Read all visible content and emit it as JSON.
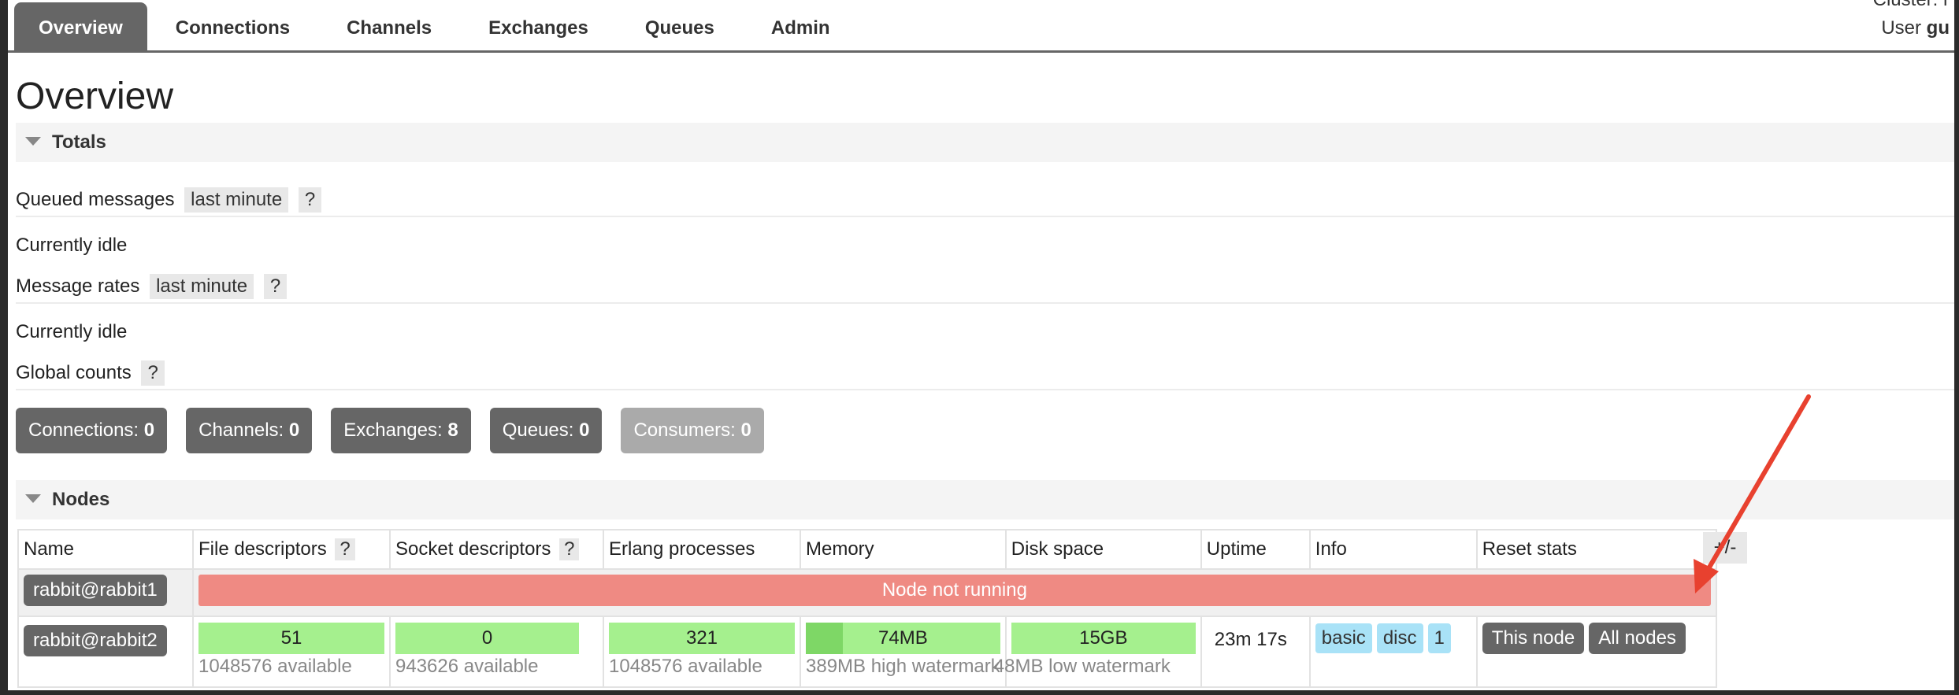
{
  "header": {
    "tabs": [
      "Overview",
      "Connections",
      "Channels",
      "Exchanges",
      "Queues",
      "Admin"
    ],
    "active_tab": "Overview",
    "cluster_label": "Cluster: r",
    "user_label": "User",
    "user_name": "gu"
  },
  "page_title": "Overview",
  "totals": {
    "section_title": "Totals",
    "queued_messages_label": "Queued messages",
    "queued_messages_range": "last minute",
    "queued_messages_help": "?",
    "queued_status": "Currently idle",
    "message_rates_label": "Message rates",
    "message_rates_range": "last minute",
    "message_rates_help": "?",
    "rates_status": "Currently idle",
    "global_counts_label": "Global counts",
    "global_counts_help": "?"
  },
  "counts": [
    {
      "label": "Connections:",
      "value": "0"
    },
    {
      "label": "Channels:",
      "value": "0"
    },
    {
      "label": "Exchanges:",
      "value": "8"
    },
    {
      "label": "Queues:",
      "value": "0"
    },
    {
      "label": "Consumers:",
      "value": "0"
    }
  ],
  "nodes": {
    "section_title": "Nodes",
    "columns": [
      "Name",
      "File descriptors",
      "Socket descriptors",
      "Erlang processes",
      "Memory",
      "Disk space",
      "Uptime",
      "Info",
      "Reset stats"
    ],
    "column_help": "?",
    "plus_minus": "+/-",
    "rows": [
      {
        "name": "rabbit@rabbit1",
        "status": "Node not running"
      },
      {
        "name": "rabbit@rabbit2",
        "file_descriptors": "51",
        "file_descriptors_available": "1048576 available",
        "socket_descriptors": "0",
        "socket_descriptors_available": "943626 available",
        "erlang_processes": "321",
        "erlang_processes_available": "1048576 available",
        "memory": "74MB",
        "memory_watermark": "389MB high watermark",
        "memory_fraction": 0.19,
        "disk_space": "15GB",
        "disk_watermark": "48MB low watermark",
        "uptime": "23m 17s",
        "info": [
          "basic",
          "disc",
          "1"
        ],
        "reset_buttons": [
          "This node",
          "All nodes"
        ]
      }
    ]
  },
  "colors": {
    "tab_active": "#666666",
    "not_running": "#ef8a83",
    "green_bar": "#a5f08e",
    "info_chip": "#a9e2f7",
    "annotation_arrow": "#e8412f"
  }
}
